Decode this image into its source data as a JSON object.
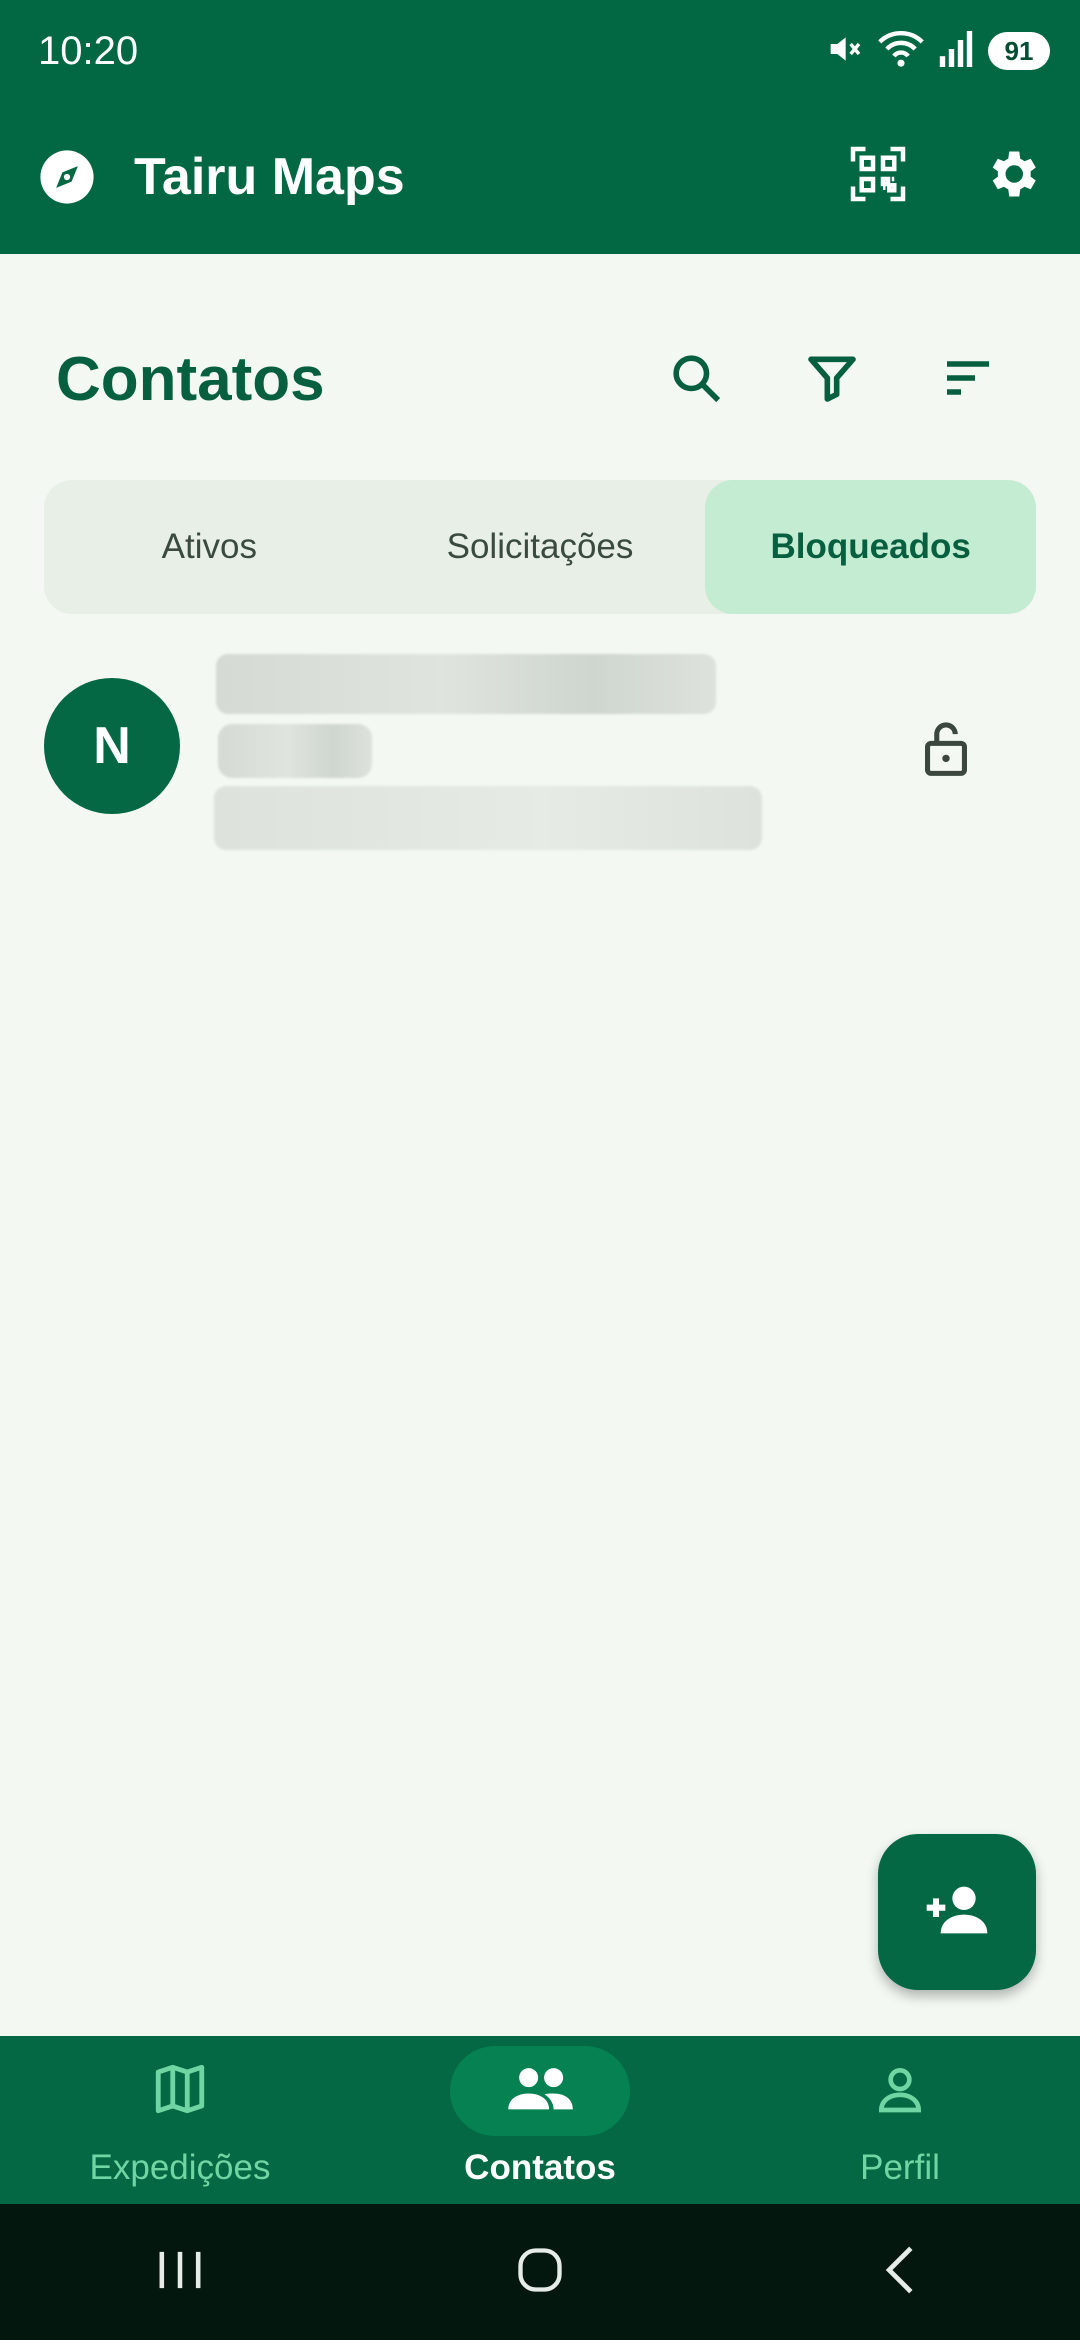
{
  "status_bar": {
    "time": "10:20",
    "battery": "91",
    "icons": [
      "mute-icon",
      "wifi-icon",
      "signal-icon"
    ]
  },
  "app_bar": {
    "title": "Tairu Maps",
    "logo_icon": "compass-icon",
    "actions": [
      "qr-code-icon",
      "gear-icon"
    ]
  },
  "header": {
    "title": "Contatos",
    "actions": [
      "search-icon",
      "filter-icon",
      "sort-icon"
    ]
  },
  "tabs": [
    {
      "label": "Ativos",
      "active": false
    },
    {
      "label": "Solicitações",
      "active": false
    },
    {
      "label": "Bloqueados",
      "active": true
    }
  ],
  "contacts": [
    {
      "initial": "N",
      "action_icon": "unlock-icon"
    }
  ],
  "fab": {
    "icon": "add-person-icon"
  },
  "bottom_nav": [
    {
      "label": "Expedições",
      "icon": "map-icon",
      "active": false
    },
    {
      "label": "Contatos",
      "icon": "group-icon",
      "active": true
    },
    {
      "label": "Perfil",
      "icon": "person-icon",
      "active": false
    }
  ],
  "colors": {
    "primary": "#036843",
    "background": "#f3f8f2",
    "tab_active": "#c3ecd2",
    "nav_inactive_label": "#6fd5a2",
    "system_nav": "#04170f"
  }
}
